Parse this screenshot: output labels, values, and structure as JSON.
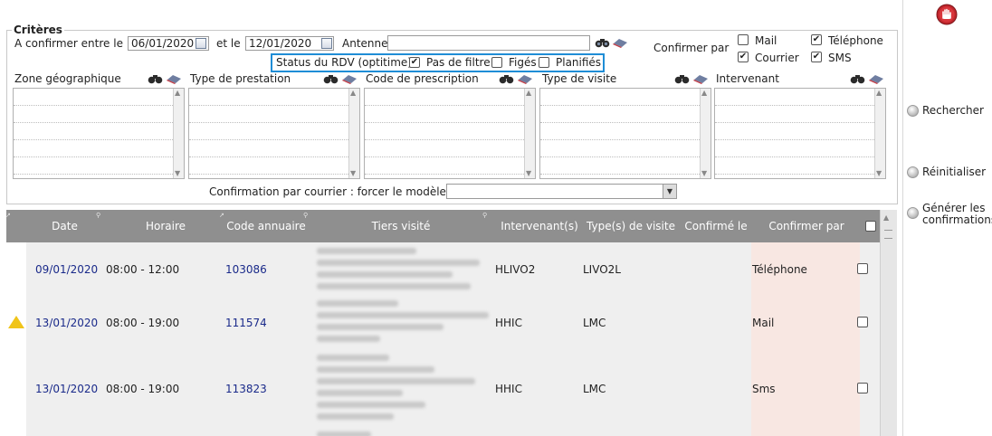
{
  "criteria": {
    "title": "Critères",
    "date_from_label": "A confirmer entre le",
    "date_from": "06/01/2020",
    "date_and_label": "et le",
    "date_to": "12/01/2020",
    "antenne_label": "Antenne",
    "antenne_value": "",
    "confirm_by_label": "Confirmer par",
    "confirm_options": [
      {
        "label": "Mail",
        "checked": false
      },
      {
        "label": "Téléphone",
        "checked": true
      },
      {
        "label": "Courrier",
        "checked": true
      },
      {
        "label": "SMS",
        "checked": true
      }
    ],
    "status": {
      "label": "Status du RDV (optitime)",
      "options": [
        {
          "label": "Pas de filtre",
          "checked": true
        },
        {
          "label": "Figés",
          "checked": false
        },
        {
          "label": "Planifiés",
          "checked": false
        }
      ]
    },
    "filters": [
      {
        "label": "Zone géographique"
      },
      {
        "label": "Type de prestation"
      },
      {
        "label": "Code de prescription"
      },
      {
        "label": "Type de visite"
      },
      {
        "label": "Intervenant"
      }
    ],
    "courrier_model_label": "Confirmation par courrier : forcer le modèle",
    "courrier_model_value": ""
  },
  "table": {
    "columns": [
      "Date",
      "Horaire",
      "Code annuaire",
      "Tiers visité",
      "Intervenant(s)",
      "Type(s) de visite",
      "Confirmé le",
      "Confirmer par"
    ],
    "rows": [
      {
        "date": "09/01/2020",
        "horaire": "08:00 - 12:00",
        "code": "103086",
        "intervenant": "HLIVO2",
        "type": "LIVO2L",
        "confirme_le": "",
        "confirmer_par": "Téléphone",
        "warning": false
      },
      {
        "date": "13/01/2020",
        "horaire": "08:00 - 19:00",
        "code": "111574",
        "intervenant": "HHIC",
        "type": "LMC",
        "confirme_le": "",
        "confirmer_par": "Mail",
        "warning": true
      },
      {
        "date": "13/01/2020",
        "horaire": "08:00 - 19:00",
        "code": "113823",
        "intervenant": "HHIC",
        "type": "LMC",
        "confirme_le": "",
        "confirmer_par": "Sms",
        "warning": false
      }
    ]
  },
  "sidebar": {
    "search_label": "Rechercher",
    "reset_label": "Réinitialiser",
    "generate_label_1": "Générer les",
    "generate_label_2": "confirmations"
  },
  "colors": {
    "accent": "#1f8dd6",
    "header_gray": "#8f8f8f",
    "confirm_col": "#f8e7e2",
    "link": "#1a2a8a",
    "stop_red": "#c0272d"
  }
}
